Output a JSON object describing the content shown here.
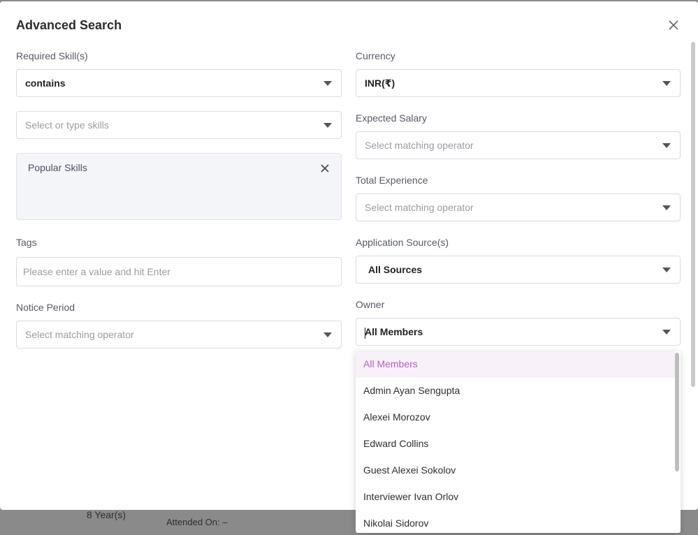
{
  "background": {
    "experience": "8 Year(s)",
    "attended": "Attended On: –"
  },
  "modal": {
    "title": "Advanced Search",
    "required_skills": {
      "label": "Required Skill(s)",
      "operator": "contains",
      "skills_placeholder": "Select or type skills"
    },
    "popular_skills": {
      "title": "Popular Skills"
    },
    "tags": {
      "label": "Tags",
      "placeholder": "Please enter a value and hit Enter"
    },
    "notice_period": {
      "label": "Notice Period",
      "placeholder": "Select matching operator"
    },
    "currency": {
      "label": "Currency",
      "value": "INR(₹)"
    },
    "expected_salary": {
      "label": "Expected Salary",
      "placeholder": "Select matching operator"
    },
    "total_experience": {
      "label": "Total Experience",
      "placeholder": "Select matching operator"
    },
    "application_source": {
      "label": "Application Source(s)",
      "value": "All Sources"
    },
    "owner": {
      "label": "Owner",
      "value": "All Members",
      "options": [
        "All Members",
        "Admin Ayan Sengupta",
        "Alexei Morozov",
        "Edward Collins",
        "Guest Alexei Sokolov",
        "Interviewer Ivan Orlov",
        "Nikolai Sidorov"
      ]
    }
  },
  "colors": {
    "accent": "#b563c3",
    "selected_bg": "#f8f1f9",
    "panel_bg": "#f4f5f9"
  }
}
